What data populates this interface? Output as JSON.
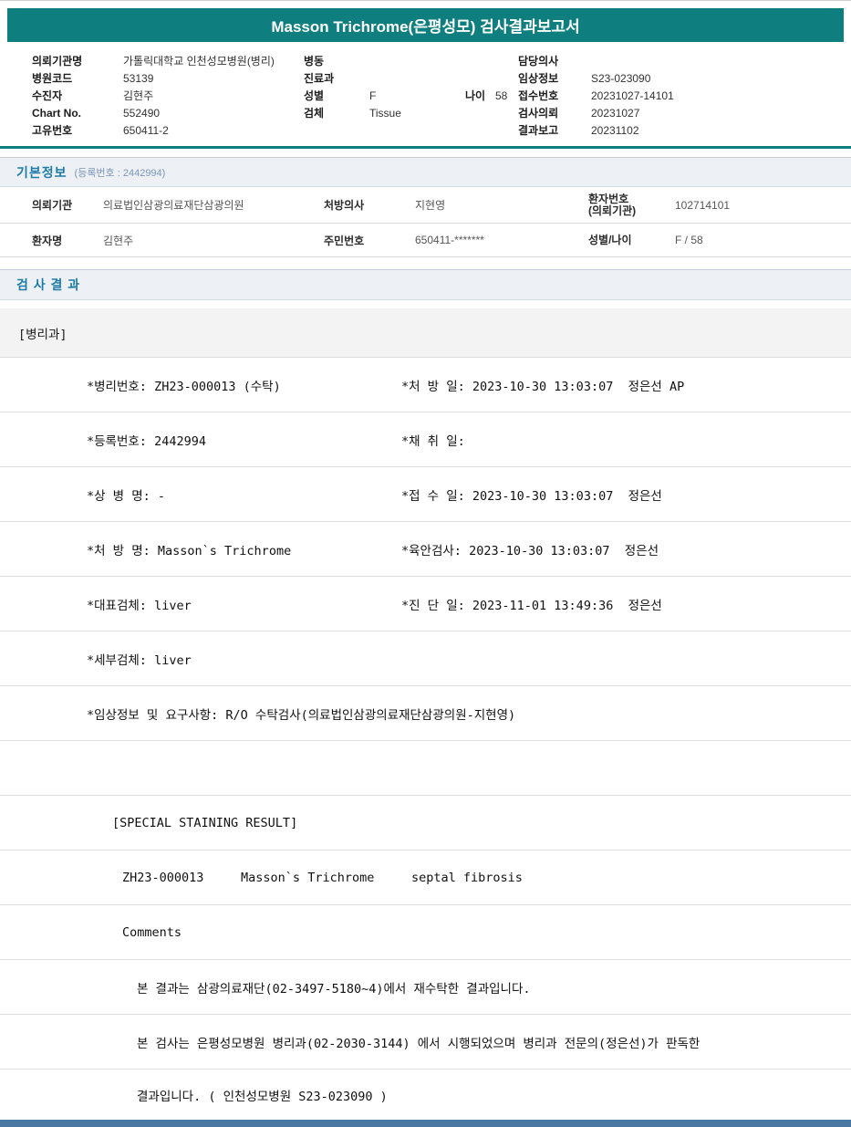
{
  "title": "Masson Trichrome(은평성모) 검사결과보고서",
  "colors": {
    "header_teal": "#0e7e7e",
    "section_title_blue": "#1e7ba8",
    "bottom_bar_blue": "#4a78a3"
  },
  "patient_header": {
    "left": [
      {
        "label": "의뢰기관명",
        "value": "가톨릭대학교 인천성모병원(병리)"
      },
      {
        "label": "병원코드",
        "value": "53139"
      },
      {
        "label": "수진자",
        "value": "김현주"
      },
      {
        "label": "Chart No.",
        "value": "552490"
      },
      {
        "label": "고유번호",
        "value": "650411-2"
      }
    ],
    "middle": [
      {
        "label": "병동",
        "value": ""
      },
      {
        "label": "진료과",
        "value": ""
      },
      {
        "label": "성별",
        "value": "F",
        "extra_label": "나이",
        "extra_value": "58"
      },
      {
        "label": "검체",
        "value": "Tissue"
      }
    ],
    "right": [
      {
        "label": "담당의사",
        "value": ""
      },
      {
        "label": "임상정보",
        "value": "S23-023090"
      },
      {
        "label": "접수번호",
        "value": "20231027-14101"
      },
      {
        "label": "검사의뢰",
        "value": "20231027"
      },
      {
        "label": "결과보고",
        "value": "20231102"
      }
    ]
  },
  "basic_info": {
    "section_title": "기본정보",
    "section_sub": "(등록번호 : 2442994)",
    "row1": {
      "c1_label": "의뢰기관",
      "c1_value": "의료법인삼광의료재단삼광의원",
      "c2_label": "처방의사",
      "c2_value": "지현영",
      "c3_label": "환자번호\n(의뢰기관)",
      "c3_value": "102714101"
    },
    "row2": {
      "c1_label": "환자명",
      "c1_value": "김현주",
      "c2_label": "주민번호",
      "c2_value": "650411-*******",
      "c3_label": "성별/나이",
      "c3_value": "F / 58"
    }
  },
  "results": {
    "section_title": "검 사 결 과",
    "department": "[병리과]",
    "lines": [
      {
        "left": "*병리번호: ZH23-000013 (수탁)",
        "right": "*처 방 일: 2023-10-30 13:03:07  정은선 AP"
      },
      {
        "left": "*등록번호: 2442994",
        "right": "*채 취 일:"
      },
      {
        "left": "*상 병 명: -",
        "right": "*접 수 일: 2023-10-30 13:03:07  정은선"
      },
      {
        "left": "*처 방 명: Masson`s Trichrome",
        "right": "*육안검사: 2023-10-30 13:03:07  정은선"
      },
      {
        "left": "*대표검체: liver",
        "right": "*진 단 일: 2023-11-01 13:49:36  정은선"
      },
      {
        "left": "*세부검체: liver",
        "right": ""
      },
      {
        "left": "*임상정보 및 요구사항: R/O 수탁검사(의료법인삼광의료재단삼광의원-지현영)",
        "right": ""
      },
      {
        "left": "",
        "right": ""
      },
      {
        "left": "[SPECIAL STAINING RESULT]",
        "right": ""
      },
      {
        "left": "ZH23-000013     Masson`s Trichrome     septal fibrosis",
        "right": ""
      },
      {
        "left": "Comments",
        "right": ""
      },
      {
        "left": "본 결과는 삼광의료재단(02-3497-5180~4)에서 재수탁한 결과입니다.",
        "right": ""
      },
      {
        "left": "본 검사는 은평성모병원 병리과(02-2030-3144) 에서 시행되었으며 병리과 전문의(정은선)가 판독한",
        "right": ""
      },
      {
        "left": "결과입니다. ( 인천성모병원 S23-023090 )",
        "right": ""
      }
    ]
  }
}
